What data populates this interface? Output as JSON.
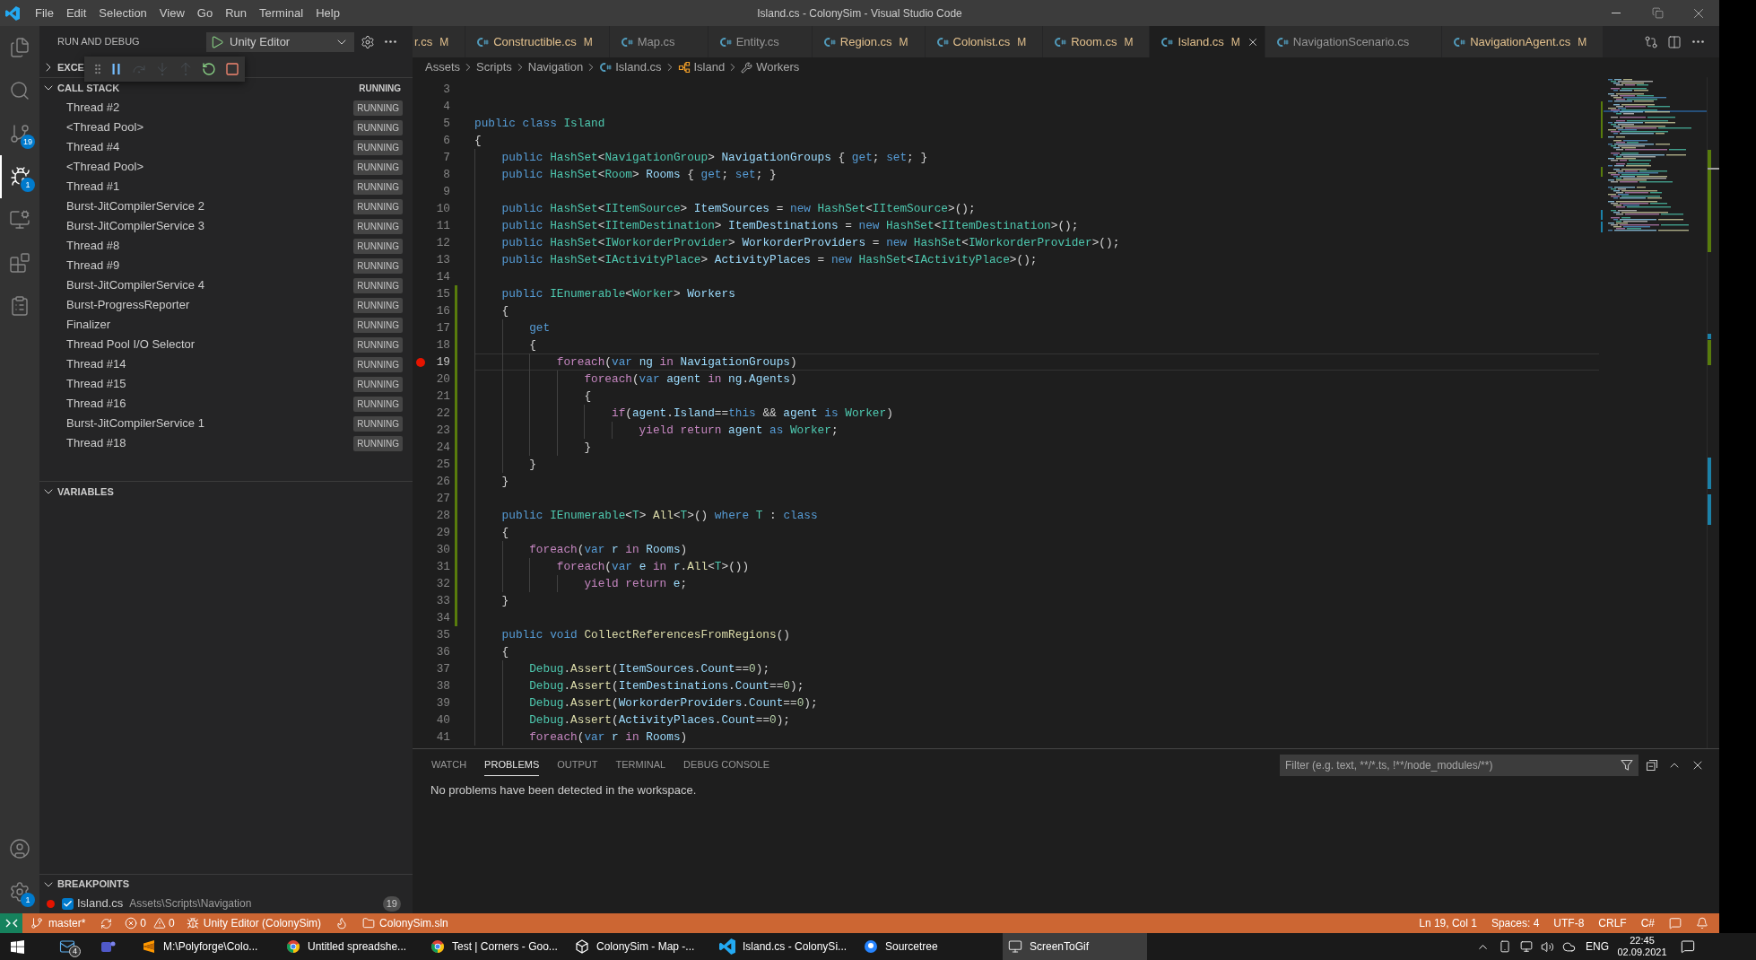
{
  "window": {
    "title": "Island.cs - ColonySim - Visual Studio Code"
  },
  "menu": [
    "File",
    "Edit",
    "Selection",
    "View",
    "Go",
    "Run",
    "Terminal",
    "Help"
  ],
  "activity_bar": {
    "items": [
      {
        "kind": "explorer",
        "selected": false
      },
      {
        "kind": "search",
        "selected": false
      },
      {
        "kind": "source_control",
        "selected": false,
        "badge": "19"
      },
      {
        "kind": "run_debug",
        "selected": true,
        "badge": "1"
      },
      {
        "kind": "remote",
        "selected": false
      },
      {
        "kind": "extensions",
        "selected": false
      },
      {
        "kind": "tests",
        "selected": false
      }
    ],
    "bottom": [
      {
        "kind": "account"
      },
      {
        "kind": "manage",
        "badge": "1"
      }
    ]
  },
  "sidebar": {
    "title": "RUN AND DEBUG",
    "configuration": "Unity Editor",
    "debug_toolbar": [
      {
        "kind": "pause",
        "disabled": false
      },
      {
        "kind": "step_over",
        "disabled": true
      },
      {
        "kind": "step_into",
        "disabled": true
      },
      {
        "kind": "step_out",
        "disabled": true
      },
      {
        "kind": "restart",
        "disabled": false
      },
      {
        "kind": "stop",
        "disabled": false
      }
    ],
    "exceptions": {
      "title": "EXCE",
      "expanded": false
    },
    "call_stack": {
      "title": "CALL STACK",
      "expanded": true,
      "status": "RUNNING",
      "threads": [
        {
          "name": "Thread #2",
          "status": "RUNNING"
        },
        {
          "name": "<Thread Pool>",
          "status": "RUNNING"
        },
        {
          "name": "Thread #4",
          "status": "RUNNING"
        },
        {
          "name": "<Thread Pool>",
          "status": "RUNNING"
        },
        {
          "name": "Thread #1",
          "status": "RUNNING"
        },
        {
          "name": "Burst-JitCompilerService 2",
          "status": "RUNNING"
        },
        {
          "name": "Burst-JitCompilerService 3",
          "status": "RUNNING"
        },
        {
          "name": "Thread #8",
          "status": "RUNNING"
        },
        {
          "name": "Thread #9",
          "status": "RUNNING"
        },
        {
          "name": "Burst-JitCompilerService 4",
          "status": "RUNNING"
        },
        {
          "name": "Burst-ProgressReporter",
          "status": "RUNNING"
        },
        {
          "name": "Finalizer",
          "status": "RUNNING"
        },
        {
          "name": "Thread Pool I/O Selector",
          "status": "RUNNING"
        },
        {
          "name": "Thread #14",
          "status": "RUNNING"
        },
        {
          "name": "Thread #15",
          "status": "RUNNING"
        },
        {
          "name": "Thread #16",
          "status": "RUNNING"
        },
        {
          "name": "Burst-JitCompilerService 1",
          "status": "RUNNING"
        },
        {
          "name": "Thread #18",
          "status": "RUNNING"
        }
      ]
    },
    "variables": {
      "title": "VARIABLES",
      "expanded": true
    },
    "breakpoints": {
      "title": "BREAKPOINTS",
      "expanded": true,
      "items": [
        {
          "file": "Island.cs",
          "folder": "Assets\\Scripts\\Navigation",
          "line": "19",
          "checked": true
        }
      ]
    }
  },
  "editor": {
    "tabs": [
      {
        "kind": "clipped",
        "label": "r.cs",
        "git_status": "M",
        "selected": false
      },
      {
        "kind": "file",
        "label": "Constructible.cs",
        "git_status": "M",
        "selected": false
      },
      {
        "kind": "file",
        "label": "Map.cs",
        "selected": false
      },
      {
        "kind": "file",
        "label": "Entity.cs",
        "selected": false
      },
      {
        "kind": "file",
        "label": "Region.cs",
        "git_status": "M",
        "selected": false
      },
      {
        "kind": "file",
        "label": "Colonist.cs",
        "git_status": "M",
        "selected": false
      },
      {
        "kind": "file",
        "label": "Room.cs",
        "git_status": "M",
        "selected": false
      },
      {
        "kind": "file",
        "label": "Island.cs",
        "git_status": "M",
        "selected": true
      },
      {
        "kind": "file",
        "label": "NavigationScenario.cs",
        "selected": false
      },
      {
        "kind": "file",
        "label": "NavigationAgent.cs",
        "git_status": "M",
        "selected": false
      }
    ],
    "breadcrumbs": [
      {
        "kind": "folder",
        "label": "Assets"
      },
      {
        "kind": "folder",
        "label": "Scripts"
      },
      {
        "kind": "folder",
        "label": "Navigation"
      },
      {
        "kind": "file",
        "label": "Island.cs"
      },
      {
        "kind": "class",
        "label": "Island"
      },
      {
        "kind": "property",
        "label": "Workers"
      }
    ],
    "lines": [
      {
        "number": "3",
        "current": false,
        "breakpoint": false,
        "modified": false
      },
      {
        "number": "4",
        "current": false,
        "breakpoint": false,
        "modified": false
      },
      {
        "number": "5",
        "current": false,
        "breakpoint": false,
        "modified": false,
        "tokens": [
          {
            "kind": "keyword",
            "text": "public class "
          },
          {
            "kind": "type",
            "text": "Island"
          }
        ]
      },
      {
        "number": "6",
        "current": false,
        "breakpoint": false,
        "modified": false,
        "tokens": [
          {
            "kind": "plain",
            "text": "{"
          }
        ]
      },
      {
        "number": "7",
        "current": false,
        "breakpoint": false,
        "modified": false,
        "tokens": [
          {
            "kind": "keyword",
            "text": "    public "
          },
          {
            "kind": "type",
            "text": "HashSet"
          },
          {
            "kind": "plain",
            "text": "<"
          },
          {
            "kind": "type",
            "text": "NavigationGroup"
          },
          {
            "kind": "plain",
            "text": "> "
          },
          {
            "kind": "variable",
            "text": "NavigationGroups"
          },
          {
            "kind": "plain",
            "text": " { "
          },
          {
            "kind": "keyword",
            "text": "get"
          },
          {
            "kind": "plain",
            "text": "; "
          },
          {
            "kind": "keyword",
            "text": "set"
          },
          {
            "kind": "plain",
            "text": "; }"
          }
        ]
      },
      {
        "number": "8",
        "current": false,
        "breakpoint": false,
        "modified": false,
        "tokens": [
          {
            "kind": "keyword",
            "text": "    public "
          },
          {
            "kind": "type",
            "text": "HashSet"
          },
          {
            "kind": "plain",
            "text": "<"
          },
          {
            "kind": "type",
            "text": "Room"
          },
          {
            "kind": "plain",
            "text": "> "
          },
          {
            "kind": "variable",
            "text": "Rooms"
          },
          {
            "kind": "plain",
            "text": " { "
          },
          {
            "kind": "keyword",
            "text": "get"
          },
          {
            "kind": "plain",
            "text": "; "
          },
          {
            "kind": "keyword",
            "text": "set"
          },
          {
            "kind": "plain",
            "text": "; }"
          }
        ]
      },
      {
        "number": "9",
        "current": false,
        "breakpoint": false,
        "modified": false
      },
      {
        "number": "10",
        "current": false,
        "breakpoint": false,
        "modified": false,
        "tokens": [
          {
            "kind": "keyword",
            "text": "    public "
          },
          {
            "kind": "type",
            "text": "HashSet"
          },
          {
            "kind": "plain",
            "text": "<"
          },
          {
            "kind": "type",
            "text": "IItemSource"
          },
          {
            "kind": "plain",
            "text": "> "
          },
          {
            "kind": "variable",
            "text": "ItemSources"
          },
          {
            "kind": "plain",
            "text": " = "
          },
          {
            "kind": "keyword",
            "text": "new "
          },
          {
            "kind": "type",
            "text": "HashSet"
          },
          {
            "kind": "plain",
            "text": "<"
          },
          {
            "kind": "type",
            "text": "IItemSource"
          },
          {
            "kind": "plain",
            "text": ">();"
          }
        ]
      },
      {
        "number": "11",
        "current": false,
        "breakpoint": false,
        "modified": false,
        "tokens": [
          {
            "kind": "keyword",
            "text": "    public "
          },
          {
            "kind": "type",
            "text": "HashSet"
          },
          {
            "kind": "plain",
            "text": "<"
          },
          {
            "kind": "type",
            "text": "IItemDestination"
          },
          {
            "kind": "plain",
            "text": "> "
          },
          {
            "kind": "variable",
            "text": "ItemDestinations"
          },
          {
            "kind": "plain",
            "text": " = "
          },
          {
            "kind": "keyword",
            "text": "new "
          },
          {
            "kind": "type",
            "text": "HashSet"
          },
          {
            "kind": "plain",
            "text": "<"
          },
          {
            "kind": "type",
            "text": "IItemDestination"
          },
          {
            "kind": "plain",
            "text": ">();"
          }
        ]
      },
      {
        "number": "12",
        "current": false,
        "breakpoint": false,
        "modified": false,
        "tokens": [
          {
            "kind": "keyword",
            "text": "    public "
          },
          {
            "kind": "type",
            "text": "HashSet"
          },
          {
            "kind": "plain",
            "text": "<"
          },
          {
            "kind": "type",
            "text": "IWorkorderProvider"
          },
          {
            "kind": "plain",
            "text": "> "
          },
          {
            "kind": "variable",
            "text": "WorkorderProviders"
          },
          {
            "kind": "plain",
            "text": " = "
          },
          {
            "kind": "keyword",
            "text": "new "
          },
          {
            "kind": "type",
            "text": "HashSet"
          },
          {
            "kind": "plain",
            "text": "<"
          },
          {
            "kind": "type",
            "text": "IWorkorderProvider"
          },
          {
            "kind": "plain",
            "text": ">();"
          }
        ]
      },
      {
        "number": "13",
        "current": false,
        "breakpoint": false,
        "modified": false,
        "tokens": [
          {
            "kind": "keyword",
            "text": "    public "
          },
          {
            "kind": "type",
            "text": "HashSet"
          },
          {
            "kind": "plain",
            "text": "<"
          },
          {
            "kind": "type",
            "text": "IActivityPlace"
          },
          {
            "kind": "plain",
            "text": "> "
          },
          {
            "kind": "variable",
            "text": "ActivityPlaces"
          },
          {
            "kind": "plain",
            "text": " = "
          },
          {
            "kind": "keyword",
            "text": "new "
          },
          {
            "kind": "type",
            "text": "HashSet"
          },
          {
            "kind": "plain",
            "text": "<"
          },
          {
            "kind": "type",
            "text": "IActivityPlace"
          },
          {
            "kind": "plain",
            "text": ">();"
          }
        ]
      },
      {
        "number": "14",
        "current": false,
        "breakpoint": false,
        "modified": false
      },
      {
        "number": "15",
        "current": false,
        "breakpoint": false,
        "modified": true,
        "tokens": [
          {
            "kind": "keyword",
            "text": "    public "
          },
          {
            "kind": "type",
            "text": "IEnumerable"
          },
          {
            "kind": "plain",
            "text": "<"
          },
          {
            "kind": "type",
            "text": "Worker"
          },
          {
            "kind": "plain",
            "text": "> "
          },
          {
            "kind": "variable",
            "text": "Workers"
          }
        ]
      },
      {
        "number": "16",
        "current": false,
        "breakpoint": false,
        "modified": true,
        "tokens": [
          {
            "kind": "plain",
            "text": "    {"
          }
        ]
      },
      {
        "number": "17",
        "current": false,
        "breakpoint": false,
        "modified": true,
        "tokens": [
          {
            "kind": "keyword",
            "text": "        get"
          }
        ]
      },
      {
        "number": "18",
        "current": false,
        "breakpoint": false,
        "modified": true,
        "tokens": [
          {
            "kind": "plain",
            "text": "        {"
          }
        ]
      },
      {
        "number": "19",
        "current": true,
        "breakpoint": true,
        "modified": true,
        "tokens": [
          {
            "kind": "control",
            "text": "            foreach"
          },
          {
            "kind": "plain",
            "text": "("
          },
          {
            "kind": "keyword",
            "text": "var "
          },
          {
            "kind": "variable",
            "text": "ng "
          },
          {
            "kind": "control",
            "text": "in "
          },
          {
            "kind": "variable",
            "text": "NavigationGroups"
          },
          {
            "kind": "plain",
            "text": ")"
          }
        ]
      },
      {
        "number": "20",
        "current": false,
        "breakpoint": false,
        "modified": true,
        "tokens": [
          {
            "kind": "control",
            "text": "                foreach"
          },
          {
            "kind": "plain",
            "text": "("
          },
          {
            "kind": "keyword",
            "text": "var "
          },
          {
            "kind": "variable",
            "text": "agent "
          },
          {
            "kind": "control",
            "text": "in "
          },
          {
            "kind": "variable",
            "text": "ng"
          },
          {
            "kind": "plain",
            "text": "."
          },
          {
            "kind": "variable",
            "text": "Agents"
          },
          {
            "kind": "plain",
            "text": ")"
          }
        ]
      },
      {
        "number": "21",
        "current": false,
        "breakpoint": false,
        "modified": true,
        "tokens": [
          {
            "kind": "plain",
            "text": "                {"
          }
        ]
      },
      {
        "number": "22",
        "current": false,
        "breakpoint": false,
        "modified": true,
        "tokens": [
          {
            "kind": "control",
            "text": "                    if"
          },
          {
            "kind": "plain",
            "text": "("
          },
          {
            "kind": "variable",
            "text": "agent"
          },
          {
            "kind": "plain",
            "text": "."
          },
          {
            "kind": "variable",
            "text": "Island"
          },
          {
            "kind": "plain",
            "text": "=="
          },
          {
            "kind": "keyword",
            "text": "this"
          },
          {
            "kind": "plain",
            "text": " && "
          },
          {
            "kind": "variable",
            "text": "agent "
          },
          {
            "kind": "keyword",
            "text": "is "
          },
          {
            "kind": "type",
            "text": "Worker"
          },
          {
            "kind": "plain",
            "text": ")"
          }
        ]
      },
      {
        "number": "23",
        "current": false,
        "breakpoint": false,
        "modified": true,
        "tokens": [
          {
            "kind": "control",
            "text": "                        yield return "
          },
          {
            "kind": "variable",
            "text": "agent "
          },
          {
            "kind": "keyword",
            "text": "as "
          },
          {
            "kind": "type",
            "text": "Worker"
          },
          {
            "kind": "plain",
            "text": ";"
          }
        ]
      },
      {
        "number": "24",
        "current": false,
        "breakpoint": false,
        "modified": true,
        "tokens": [
          {
            "kind": "plain",
            "text": "                }"
          }
        ]
      },
      {
        "number": "25",
        "current": false,
        "breakpoint": false,
        "modified": true,
        "tokens": [
          {
            "kind": "plain",
            "text": "        }"
          }
        ]
      },
      {
        "number": "26",
        "current": false,
        "breakpoint": false,
        "modified": true,
        "tokens": [
          {
            "kind": "plain",
            "text": "    }"
          }
        ]
      },
      {
        "number": "27",
        "current": false,
        "breakpoint": false,
        "modified": true
      },
      {
        "number": "28",
        "current": false,
        "breakpoint": false,
        "modified": true,
        "tokens": [
          {
            "kind": "keyword",
            "text": "    public "
          },
          {
            "kind": "type",
            "text": "IEnumerable"
          },
          {
            "kind": "plain",
            "text": "<"
          },
          {
            "kind": "type",
            "text": "T"
          },
          {
            "kind": "plain",
            "text": "> "
          },
          {
            "kind": "function",
            "text": "All"
          },
          {
            "kind": "plain",
            "text": "<"
          },
          {
            "kind": "type",
            "text": "T"
          },
          {
            "kind": "plain",
            "text": ">() "
          },
          {
            "kind": "keyword",
            "text": "where "
          },
          {
            "kind": "type",
            "text": "T"
          },
          {
            "kind": "plain",
            "text": " : "
          },
          {
            "kind": "keyword",
            "text": "class"
          }
        ]
      },
      {
        "number": "29",
        "current": false,
        "breakpoint": false,
        "modified": true,
        "tokens": [
          {
            "kind": "plain",
            "text": "    {"
          }
        ]
      },
      {
        "number": "30",
        "current": false,
        "breakpoint": false,
        "modified": true,
        "tokens": [
          {
            "kind": "control",
            "text": "        foreach"
          },
          {
            "kind": "plain",
            "text": "("
          },
          {
            "kind": "keyword",
            "text": "var "
          },
          {
            "kind": "variable",
            "text": "r "
          },
          {
            "kind": "control",
            "text": "in "
          },
          {
            "kind": "variable",
            "text": "Rooms"
          },
          {
            "kind": "plain",
            "text": ")"
          }
        ]
      },
      {
        "number": "31",
        "current": false,
        "breakpoint": false,
        "modified": true,
        "tokens": [
          {
            "kind": "control",
            "text": "            foreach"
          },
          {
            "kind": "plain",
            "text": "("
          },
          {
            "kind": "keyword",
            "text": "var "
          },
          {
            "kind": "variable",
            "text": "e "
          },
          {
            "kind": "control",
            "text": "in "
          },
          {
            "kind": "variable",
            "text": "r"
          },
          {
            "kind": "plain",
            "text": "."
          },
          {
            "kind": "function",
            "text": "All"
          },
          {
            "kind": "plain",
            "text": "<"
          },
          {
            "kind": "type",
            "text": "T"
          },
          {
            "kind": "plain",
            "text": ">())"
          }
        ]
      },
      {
        "number": "32",
        "current": false,
        "breakpoint": false,
        "modified": true,
        "tokens": [
          {
            "kind": "control",
            "text": "                yield return "
          },
          {
            "kind": "variable",
            "text": "e"
          },
          {
            "kind": "plain",
            "text": ";"
          }
        ]
      },
      {
        "number": "33",
        "current": false,
        "breakpoint": false,
        "modified": true,
        "tokens": [
          {
            "kind": "plain",
            "text": "    }"
          }
        ]
      },
      {
        "number": "34",
        "current": false,
        "breakpoint": false,
        "modified": true
      },
      {
        "number": "35",
        "current": false,
        "breakpoint": false,
        "modified": false,
        "tokens": [
          {
            "kind": "keyword",
            "text": "    public void "
          },
          {
            "kind": "function",
            "text": "CollectReferencesFromRegions"
          },
          {
            "kind": "plain",
            "text": "()"
          }
        ]
      },
      {
        "number": "36",
        "current": false,
        "breakpoint": false,
        "modified": false,
        "tokens": [
          {
            "kind": "plain",
            "text": "    {"
          }
        ]
      },
      {
        "number": "37",
        "current": false,
        "breakpoint": false,
        "modified": false,
        "tokens": [
          {
            "kind": "type",
            "text": "        Debug"
          },
          {
            "kind": "plain",
            "text": "."
          },
          {
            "kind": "function",
            "text": "Assert"
          },
          {
            "kind": "plain",
            "text": "("
          },
          {
            "kind": "variable",
            "text": "ItemSources"
          },
          {
            "kind": "plain",
            "text": "."
          },
          {
            "kind": "variable",
            "text": "Count"
          },
          {
            "kind": "plain",
            "text": "=="
          },
          {
            "kind": "number",
            "text": "0"
          },
          {
            "kind": "plain",
            "text": ");"
          }
        ]
      },
      {
        "number": "38",
        "current": false,
        "breakpoint": false,
        "modified": false,
        "tokens": [
          {
            "kind": "type",
            "text": "        Debug"
          },
          {
            "kind": "plain",
            "text": "."
          },
          {
            "kind": "function",
            "text": "Assert"
          },
          {
            "kind": "plain",
            "text": "("
          },
          {
            "kind": "variable",
            "text": "ItemDestinations"
          },
          {
            "kind": "plain",
            "text": "."
          },
          {
            "kind": "variable",
            "text": "Count"
          },
          {
            "kind": "plain",
            "text": "=="
          },
          {
            "kind": "number",
            "text": "0"
          },
          {
            "kind": "plain",
            "text": ");"
          }
        ]
      },
      {
        "number": "39",
        "current": false,
        "breakpoint": false,
        "modified": false,
        "tokens": [
          {
            "kind": "type",
            "text": "        Debug"
          },
          {
            "kind": "plain",
            "text": "."
          },
          {
            "kind": "function",
            "text": "Assert"
          },
          {
            "kind": "plain",
            "text": "("
          },
          {
            "kind": "variable",
            "text": "WorkorderProviders"
          },
          {
            "kind": "plain",
            "text": "."
          },
          {
            "kind": "variable",
            "text": "Count"
          },
          {
            "kind": "plain",
            "text": "=="
          },
          {
            "kind": "number",
            "text": "0"
          },
          {
            "kind": "plain",
            "text": ");"
          }
        ]
      },
      {
        "number": "40",
        "current": false,
        "breakpoint": false,
        "modified": false,
        "tokens": [
          {
            "kind": "type",
            "text": "        Debug"
          },
          {
            "kind": "plain",
            "text": "."
          },
          {
            "kind": "function",
            "text": "Assert"
          },
          {
            "kind": "plain",
            "text": "("
          },
          {
            "kind": "variable",
            "text": "ActivityPlaces"
          },
          {
            "kind": "plain",
            "text": "."
          },
          {
            "kind": "variable",
            "text": "Count"
          },
          {
            "kind": "plain",
            "text": "=="
          },
          {
            "kind": "number",
            "text": "0"
          },
          {
            "kind": "plain",
            "text": ");"
          }
        ]
      },
      {
        "number": "41",
        "current": false,
        "breakpoint": false,
        "modified": false,
        "tokens": [
          {
            "kind": "control",
            "text": "        foreach"
          },
          {
            "kind": "plain",
            "text": "("
          },
          {
            "kind": "keyword",
            "text": "var "
          },
          {
            "kind": "variable",
            "text": "r "
          },
          {
            "kind": "control",
            "text": "in "
          },
          {
            "kind": "variable",
            "text": "Rooms"
          },
          {
            "kind": "plain",
            "text": ")"
          }
        ]
      }
    ]
  },
  "panel": {
    "tabs": [
      {
        "label": "WATCH",
        "selected": false
      },
      {
        "label": "PROBLEMS",
        "selected": true
      },
      {
        "label": "OUTPUT",
        "selected": false
      },
      {
        "label": "TERMINAL",
        "selected": false
      },
      {
        "label": "DEBUG CONSOLE",
        "selected": false
      }
    ],
    "filter": {
      "placeholder": "Filter (e.g. text, **/*.ts, !**/node_modules/**)"
    },
    "message": "No problems have been detected in the workspace."
  },
  "status_bar": {
    "branch": "master*",
    "errors": "0",
    "warnings": "0",
    "debug_target": "Unity Editor (ColonySim)",
    "solution": "ColonySim.sln",
    "cursor": "Ln 19, Col 1",
    "indentation": "Spaces: 4",
    "encoding": "UTF-8",
    "line_endings": "CRLF",
    "language": "C#"
  },
  "taskbar": {
    "pinned": [
      {
        "kind": "mail",
        "badge": "4"
      },
      {
        "kind": "chat"
      }
    ],
    "apps": [
      {
        "kind": "text_editor",
        "label": "M:\\Polyforge\\Colo...",
        "selected": false
      },
      {
        "kind": "browser",
        "label": "Untitled spreadshe...",
        "selected": false
      },
      {
        "kind": "browser",
        "label": "Test | Corners - Goo...",
        "selected": false
      },
      {
        "kind": "game_engine",
        "label": "ColonySim - Map -...",
        "selected": false
      },
      {
        "kind": "code_editor",
        "label": "Island.cs - ColonySi...",
        "selected": false
      },
      {
        "kind": "git_client",
        "label": "Sourcetree",
        "selected": false
      },
      {
        "kind": "recorder",
        "label": "ScreenToGif",
        "selected": true
      }
    ],
    "tray": {
      "language": "ENG",
      "time": "22:45",
      "date": "02.09.2021"
    }
  }
}
